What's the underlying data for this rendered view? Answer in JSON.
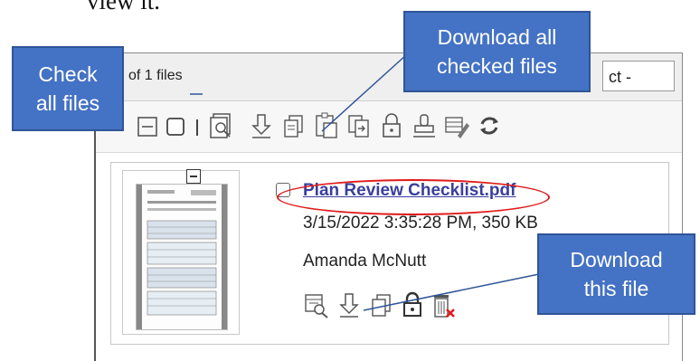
{
  "document": {
    "fragment": "view it."
  },
  "panel": {
    "files_count": "of 1 files",
    "select_text": "ct -"
  },
  "toolbar": {
    "icons": [
      "collapse-all-icon",
      "check-all-checkbox-icon",
      "separator-icon",
      "preview-icon",
      "download-icon",
      "copy-icon",
      "paste-icon",
      "move-icon",
      "lock-icon",
      "stamp-icon",
      "edit-list-icon",
      "refresh-icon"
    ]
  },
  "file": {
    "name": "Plan Review Checklist.pdf",
    "meta": "3/15/2022 3:35:28 PM, 350 KB",
    "owner": "Amanda McNutt",
    "actions": [
      "view-details-icon",
      "download-icon",
      "copy-icon",
      "lock-icon",
      "delete-icon"
    ]
  },
  "callouts": {
    "check_all": {
      "line1": "Check",
      "line2": "all files"
    },
    "download_checked": {
      "line1": "Download all",
      "line2": "checked files"
    },
    "download_this": {
      "line1": "Download",
      "line2": "this file"
    }
  },
  "colors": {
    "callout_fill": "#4472c4",
    "callout_border": "#2f5597",
    "ellipse": "#e01b1b",
    "link": "#3a3f9c"
  }
}
